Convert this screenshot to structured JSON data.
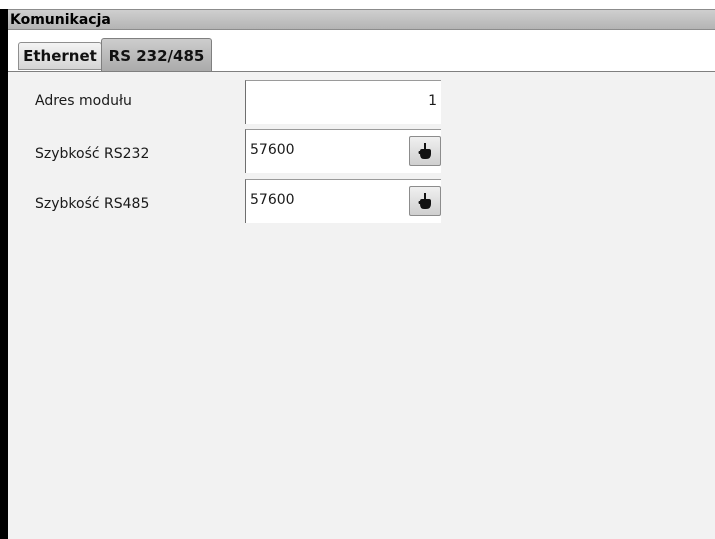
{
  "window": {
    "title": "Komunikacja"
  },
  "tabs": [
    {
      "label": "Ethernet",
      "active": false
    },
    {
      "label": "RS 232/485",
      "active": true
    }
  ],
  "form": {
    "module_address": {
      "label": "Adres modułu",
      "value": "1"
    },
    "rs232_speed": {
      "label": "Szybkość RS232",
      "value": "57600",
      "icon": "hand-pointer-icon"
    },
    "rs485_speed": {
      "label": "Szybkość RS485",
      "value": "57600",
      "icon": "hand-pointer-icon"
    }
  }
}
